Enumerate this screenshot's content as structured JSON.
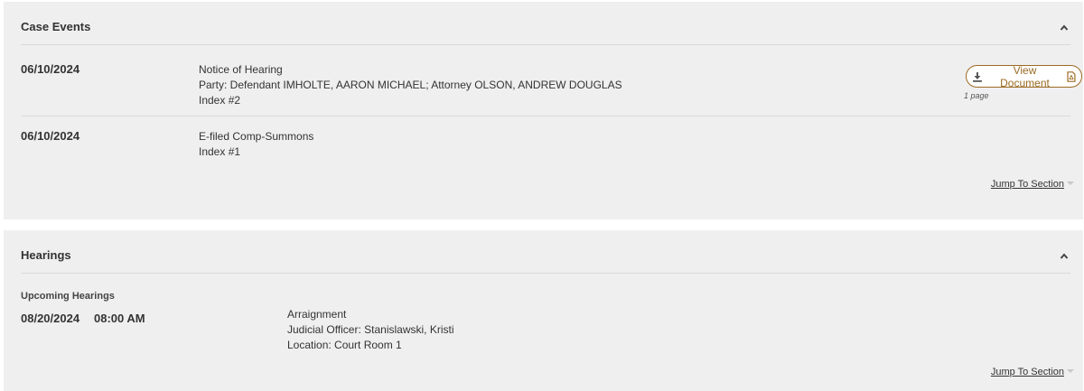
{
  "case_events": {
    "title": "Case Events",
    "events": [
      {
        "date": "06/10/2024",
        "title": "Notice of Hearing",
        "party_line": "Party:  Defendant IMHOLTE, AARON MICHAEL;   Attorney OLSON, ANDREW DOUGLAS",
        "index": "Index #2",
        "document_button": "View Document",
        "page_count": "1 page"
      },
      {
        "date": "06/10/2024",
        "title": "E-filed Comp-Summons",
        "index": "Index #1"
      }
    ],
    "jump_link": "Jump To Section"
  },
  "hearings": {
    "title": "Hearings",
    "subheading": "Upcoming Hearings",
    "items": [
      {
        "date": "08/20/2024",
        "time": "08:00 AM",
        "type": "Arraignment",
        "judicial_officer": "Judicial Officer: Stanislawski, Kristi",
        "location": "Location: Court Room 1"
      }
    ],
    "jump_link": "Jump To Section"
  },
  "colors": {
    "panel_bg": "#efefef",
    "accent": "#9b6b24",
    "divider": "#d9d9d9"
  },
  "icons": {
    "collapse": "chevron-up-icon",
    "download": "download-icon",
    "pdf": "pdf-file-icon",
    "jump_caret": "caret-down-icon"
  }
}
